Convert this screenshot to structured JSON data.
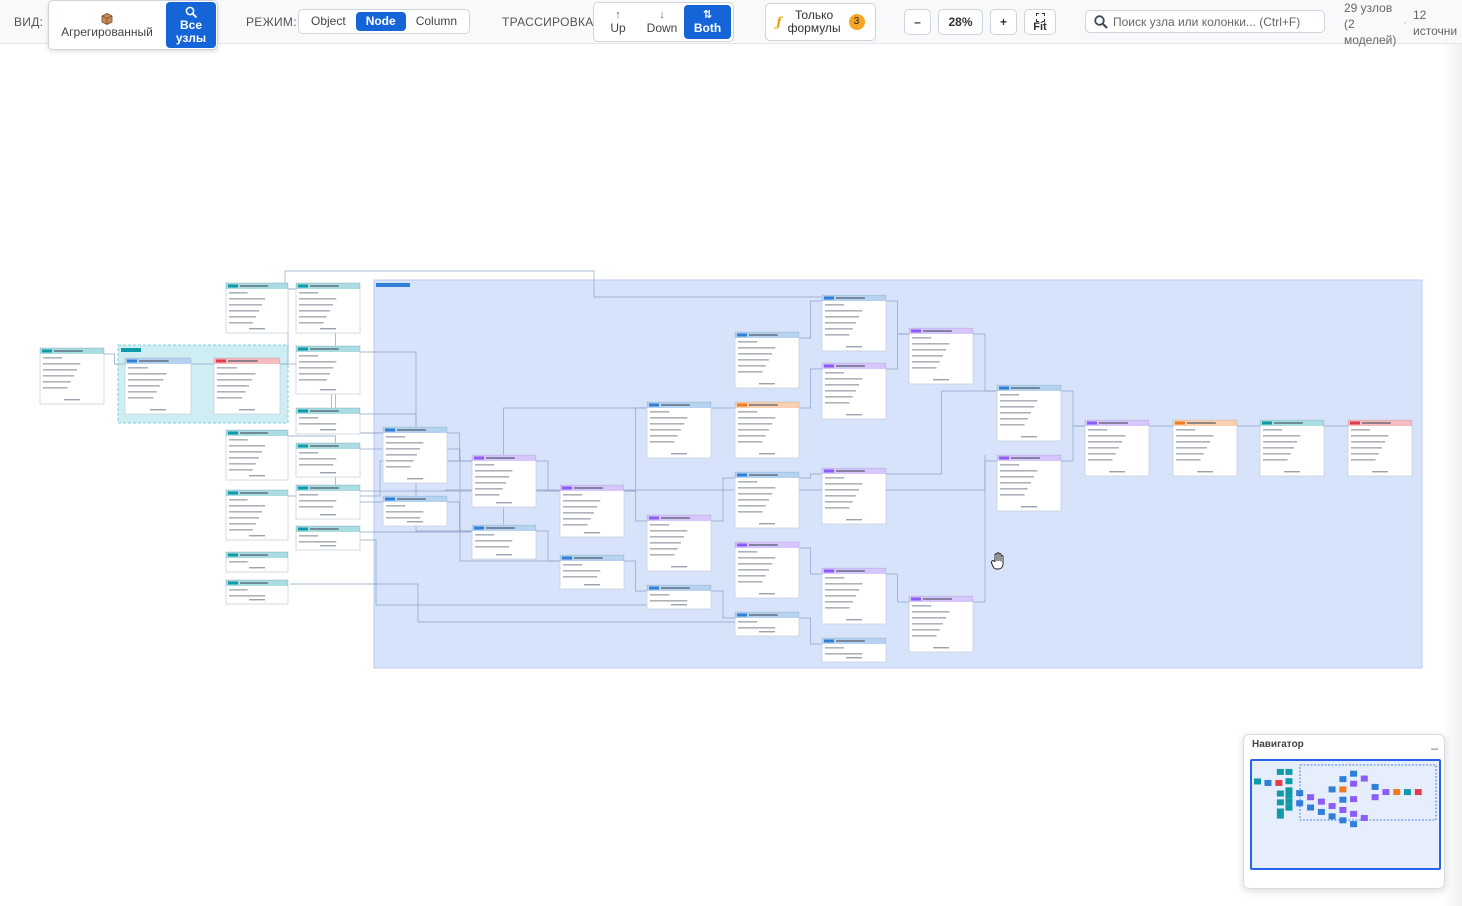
{
  "toolbar": {
    "view_label": "ВИД:",
    "view_aggregated": "Агрегированный",
    "view_all_line1": "Все",
    "view_all_line2": "узлы",
    "mode_label": "РЕЖИМ:",
    "mode_object": "Object",
    "mode_node": "Node",
    "mode_column": "Column",
    "trace_label": "ТРАССИРОВКА:",
    "trace_up": "Up",
    "trace_down": "Down",
    "trace_both": "Both",
    "formula_line1": "Только",
    "formula_line2": "формулы",
    "formula_count": "3",
    "zoom_out": "–",
    "zoom_value": "28%",
    "zoom_in": "+",
    "fit": "Fit",
    "search_placeholder": "Поиск узла или колонки... (Ctrl+F)",
    "stat_nodes_1": "29 узлов",
    "stat_nodes_2": "(2",
    "stat_nodes_3": "моделей)",
    "stat_sources_1": "12",
    "stat_sources_2": "источни"
  },
  "icons": {
    "aggregated": "cube-icon",
    "all_nodes": "magnifier-icon",
    "up": "arrow-up-icon",
    "down": "arrow-down-icon",
    "both": "arrow-up-down-icon",
    "formula": "function-icon",
    "fit": "fit-screen-icon",
    "search": "search-icon",
    "cursor": "hand-cursor-icon"
  },
  "colors": {
    "accent": "#1565d8",
    "badge": "#f5a623",
    "group_blue": "#d7e3fa",
    "group_teal": "#cfeef4",
    "header_teal": "#0f9aa8",
    "header_blue": "#2f7fd6",
    "header_purple": "#8b5cf6",
    "header_red": "#e23b4b",
    "header_orange": "#ee7b22",
    "header_gray": "#4b5563"
  },
  "navigator": {
    "title": "Навигатор",
    "minimize": "_"
  }
}
